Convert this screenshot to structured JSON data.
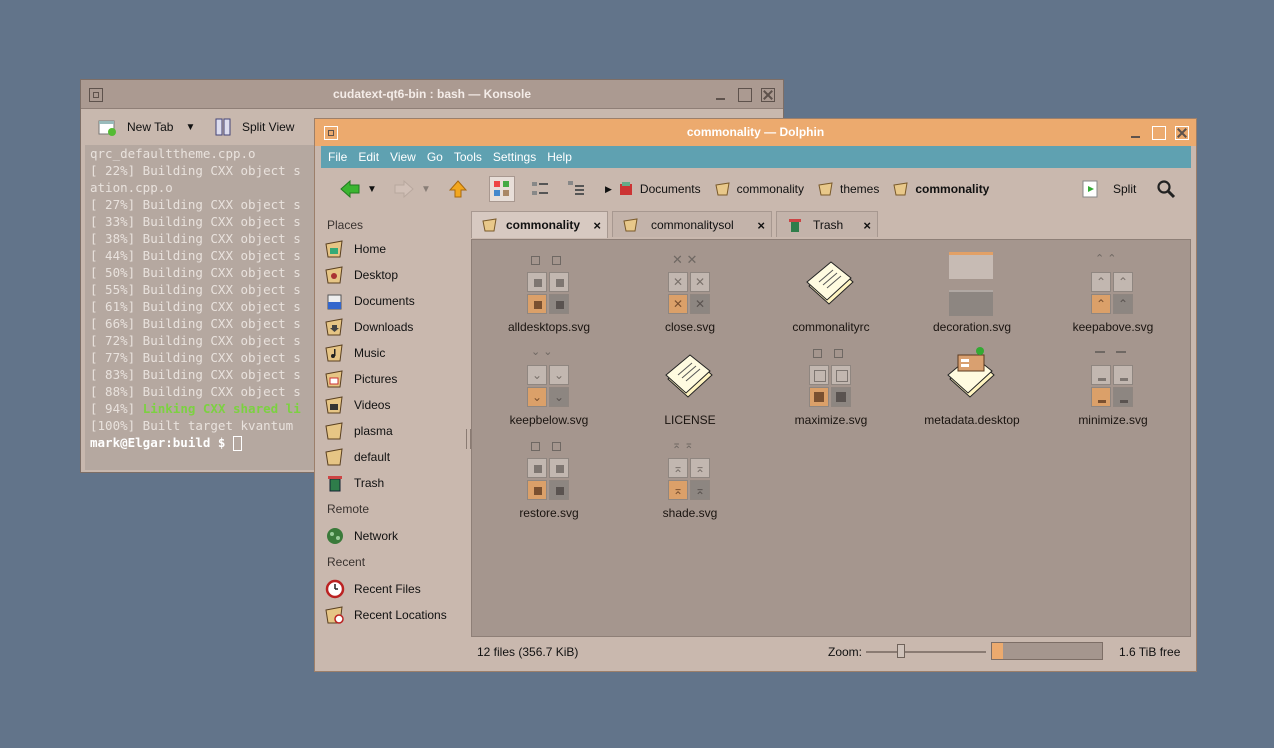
{
  "konsole": {
    "title": "cudatext-qt6-bin : bash — Konsole",
    "toolbar": {
      "new_tab": "New Tab",
      "split_view": "Split View"
    },
    "lines": [
      "qrc_defaulttheme.cpp.o",
      "[ 22%] Building CXX object s",
      "ation.cpp.o",
      "[ 27%] Building CXX object s",
      "[ 33%] Building CXX object s",
      "[ 38%] Building CXX object s",
      "[ 44%] Building CXX object s",
      "[ 50%] Building CXX object s",
      "[ 55%] Building CXX object s",
      "[ 61%] Building CXX object s",
      "[ 66%] Building CXX object s",
      "[ 72%] Building CXX object s",
      "[ 77%] Building CXX object s",
      "[ 83%] Building CXX object s",
      "[ 88%] Building CXX object s"
    ],
    "link_prefix": "[ 94%] ",
    "link_text": "Linking CXX shared li",
    "built_line": "[100%] Built target kvantum",
    "prompt": "mark@Elgar:build $ "
  },
  "dolphin": {
    "title": "commonality — Dolphin",
    "menu": [
      "File",
      "Edit",
      "View",
      "Go",
      "Tools",
      "Settings",
      "Help"
    ],
    "breadcrumb": [
      "Documents",
      "commonality",
      "themes",
      "commonality"
    ],
    "split_label": "Split",
    "places_header": "Places",
    "places": [
      "Home",
      "Desktop",
      "Documents",
      "Downloads",
      "Music",
      "Pictures",
      "Videos",
      "plasma",
      "default",
      "Trash"
    ],
    "remote_header": "Remote",
    "remote": [
      "Network"
    ],
    "recent_header": "Recent",
    "recent": [
      "Recent Files",
      "Recent Locations"
    ],
    "tabs": [
      "commonality",
      "commonalitysol",
      "Trash"
    ],
    "tab_close": "×",
    "files": [
      "alldesktops.svg",
      "close.svg",
      "commonalityrc",
      "decoration.svg",
      "keepabove.svg",
      "keepbelow.svg",
      "LICENSE",
      "maximize.svg",
      "metadata.desktop",
      "minimize.svg",
      "restore.svg",
      "shade.svg"
    ],
    "status": {
      "count": "12 files (356.7 KiB)",
      "zoom_label": "Zoom:",
      "free": "1.6 TiB free",
      "zoom_level": 0.28,
      "space_used": 0.1
    },
    "accent": "#ecaa6e",
    "menubar_color": "#5fa1b1"
  }
}
